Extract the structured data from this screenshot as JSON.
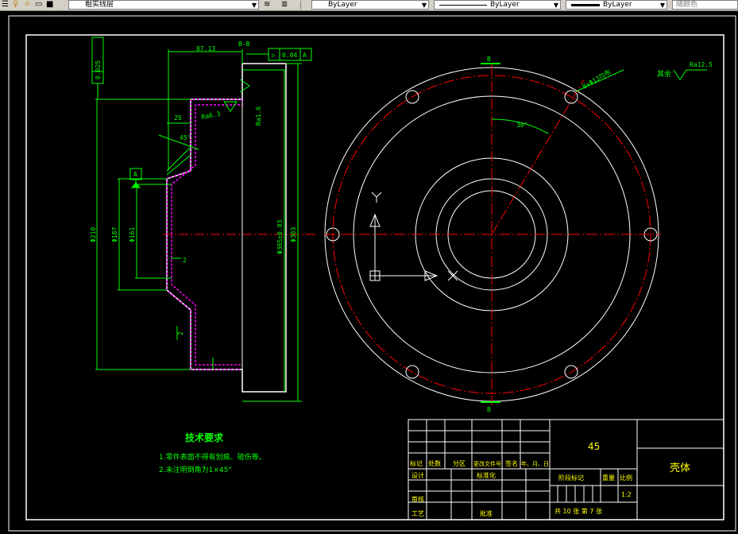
{
  "toolbar": {
    "layer_name": "粗实线层",
    "linetype_a": "ByLayer",
    "linetype_b": "ByLayer",
    "lineweight": "ByLayer",
    "color": "随颜色"
  },
  "drawing": {
    "tolerance_flatness": "0.025",
    "tolerance_box_a": "0.04",
    "datum_a": "A",
    "dim_top": "87.13",
    "section_label": "B-B",
    "roughness_1": "Ra6.3",
    "roughness_2": "Ra1.6",
    "dim_25": "25",
    "angle_45": "45°",
    "dim_2": "2",
    "dim_d210": "Φ210",
    "dim_d187": "Φ187",
    "dim_d161": "Φ161",
    "dim_d365": "Φ365±0.03",
    "dim_d383": "Φ383",
    "dim_holes": "8×Φ13均布",
    "angle_30": "30°",
    "other_surface": "其余",
    "roughness_rest": "Ra12.5",
    "ucs_y": "Y",
    "ucs_x": "X",
    "section_mark_b": "B"
  },
  "notes": {
    "title": "技术要求",
    "items": [
      "1.零件表面不得有划痕、碰伤等。",
      "2.未注明倒角为1×45°"
    ]
  },
  "title_block": {
    "material": "45",
    "part_name": "壳体",
    "header_row": [
      "标记",
      "处数",
      "分区",
      "更改文件号",
      "签名",
      "年、月、日"
    ],
    "design": "设计",
    "standardize": "标准化",
    "stage_mark": "阶段标记",
    "weight": "重量",
    "scale_label": "比例",
    "scale": "1:2",
    "review": "审核",
    "process": "工艺",
    "approve": "批准",
    "sheets": "共 10 张    第 7 张"
  },
  "colors": {
    "outline": "#ffffff",
    "dimension": "#00ff00",
    "centerline": "#ff0000",
    "hatch": "#ff00ff",
    "text_yellow": "#ffff00"
  }
}
